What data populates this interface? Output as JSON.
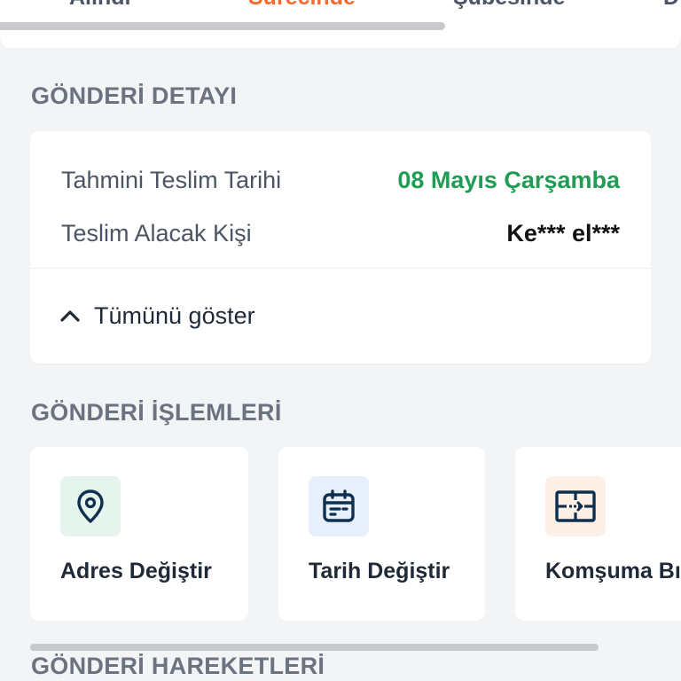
{
  "tabs": [
    {
      "label": "Alındı"
    },
    {
      "label": "Sürecinde"
    },
    {
      "label": "Şubesinde"
    },
    {
      "label": "D"
    }
  ],
  "tracking_progress": 0.654,
  "detail": {
    "section_title": "GÖNDERİ DETAYI",
    "rows": [
      {
        "label": "Tahmini Teslim Tarihi",
        "value": "08 Mayıs Çarşamba",
        "value_color": "#1f9d55"
      },
      {
        "label": "Teslim Alacak Kişi",
        "value": "Ke*** el***",
        "value_color": "#111111"
      }
    ],
    "show_all_label": "Tümünü göster"
  },
  "actions": {
    "section_title": "GÖNDERİ İŞLEMLERİ",
    "items": [
      {
        "label": "Adres Değiştir",
        "icon": "location-pin-icon",
        "icon_bg": "#e6f4ee"
      },
      {
        "label": "Tarih Değiştir",
        "icon": "calendar-icon",
        "icon_bg": "#e7effd"
      },
      {
        "label": "Komşuma Bı",
        "icon": "neighbor-transfer-icon",
        "icon_bg": "#fdf0e6"
      }
    ]
  },
  "movements": {
    "section_title": "GÖNDERİ HAREKETLERİ"
  },
  "colors": {
    "accent_orange": "#f26a2e",
    "icon_dark": "#0f2f4f",
    "background": "#f3f4f6"
  }
}
